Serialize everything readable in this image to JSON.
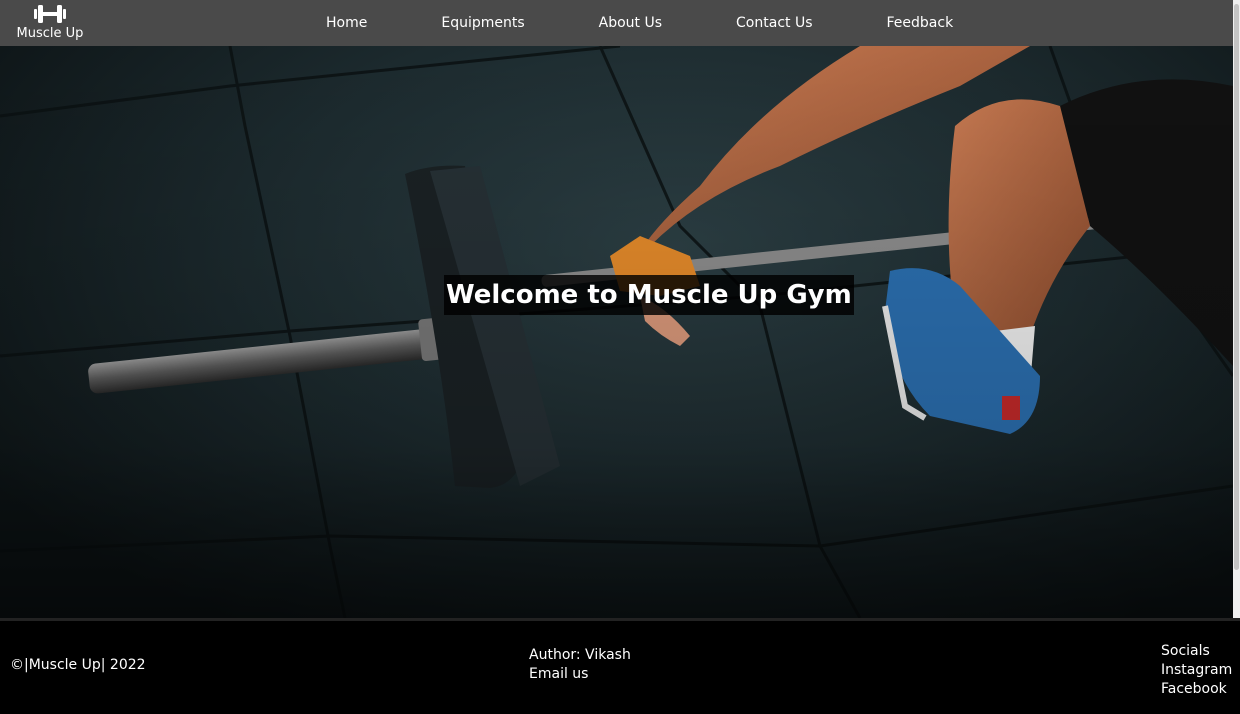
{
  "brand": {
    "name": "Muscle Up",
    "icon": "dumbbell-icon"
  },
  "nav": {
    "items": [
      {
        "label": "Home"
      },
      {
        "label": "Equipments"
      },
      {
        "label": "About Us"
      },
      {
        "label": "Contact Us"
      },
      {
        "label": "Feedback"
      }
    ]
  },
  "hero": {
    "title": "Welcome to Muscle Up Gym",
    "image": "person-lifting-barbell-photo"
  },
  "footer": {
    "copyright": "©|Muscle Up| 2022",
    "author": "Author: Vikash",
    "email_link": "Email us",
    "socials_heading": "Socials",
    "instagram": "Instagram",
    "facebook": "Facebook"
  },
  "colors": {
    "navbar_bg": "#4a4a4a",
    "footer_bg": "#000000",
    "text": "#ffffff"
  }
}
